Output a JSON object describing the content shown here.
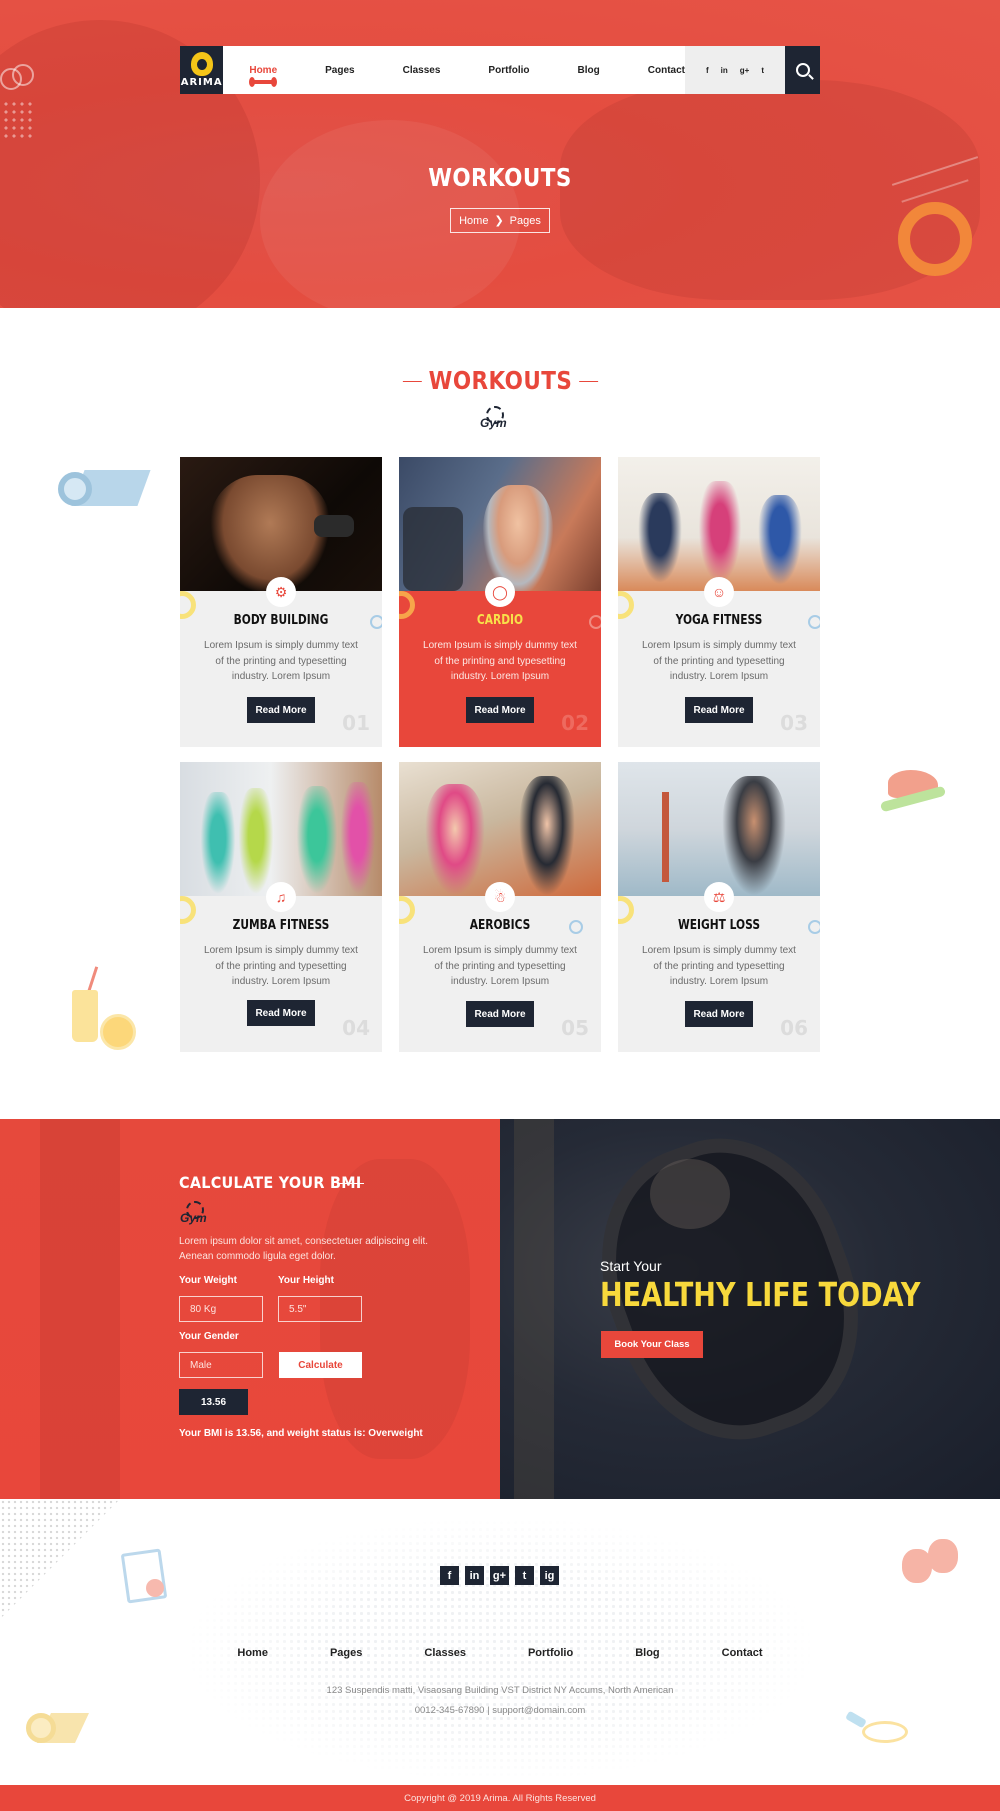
{
  "brand": {
    "name": "ARIMA",
    "accent": "#e8473b",
    "dark": "#1e2533",
    "yellow": "#f8d93c"
  },
  "nav": {
    "items": [
      {
        "label": "Home",
        "active": true
      },
      {
        "label": "Pages"
      },
      {
        "label": "Classes"
      },
      {
        "label": "Portfolio"
      },
      {
        "label": "Blog"
      },
      {
        "label": "Contact"
      }
    ],
    "social": [
      "f",
      "in",
      "g+",
      "t"
    ],
    "search_icon": "search-icon"
  },
  "hero": {
    "title": "WORKOUTS",
    "breadcrumb": {
      "home": "Home",
      "current": "Pages"
    }
  },
  "workouts": {
    "title": "WORKOUTS",
    "mark": "Gym",
    "cards": [
      {
        "title": "BODY BUILDING",
        "desc": "Lorem Ipsum is simply dummy text of the printing and typesetting industry. Lorem Ipsum",
        "button": "Read More",
        "num": "01",
        "icon": "dumbbell-icon",
        "highlight": false
      },
      {
        "title": "CARDIO",
        "desc": "Lorem Ipsum is simply dummy text of the printing and typesetting industry. Lorem Ipsum",
        "button": "Read More",
        "num": "02",
        "icon": "bike-icon",
        "highlight": true
      },
      {
        "title": "YOGA FITNESS",
        "desc": "Lorem Ipsum is simply dummy text of the printing and typesetting industry. Lorem Ipsum",
        "button": "Read More",
        "num": "03",
        "icon": "yoga-icon",
        "highlight": false
      },
      {
        "title": "ZUMBA FITNESS",
        "desc": "Lorem Ipsum is simply dummy text of the printing and typesetting industry. Lorem Ipsum",
        "button": "Read More",
        "num": "04",
        "icon": "dance-icon",
        "highlight": false
      },
      {
        "title": "AEROBICS",
        "desc": "Lorem Ipsum is simply dummy text of the printing and typesetting industry. Lorem Ipsum",
        "button": "Read More",
        "num": "05",
        "icon": "aerobics-icon",
        "highlight": false
      },
      {
        "title": "WEIGHT LOSS",
        "desc": "Lorem Ipsum is simply dummy text of the printing and typesetting industry. Lorem Ipsum",
        "button": "Read More",
        "num": "06",
        "icon": "scale-icon",
        "highlight": false
      }
    ]
  },
  "bmi": {
    "title": "CALCULATE YOUR BMI",
    "mark": "Gym",
    "desc": "Lorem ipsum dolor sit amet, consectetuer adipiscing elit. Aenean commodo ligula eget dolor.",
    "weight_label": "Your Weight",
    "weight_value": "80 Kg",
    "height_label": "Your Height",
    "height_value": "5.5\"",
    "gender_label": "Your Gender",
    "gender_value": "Male",
    "calculate": "Calculate",
    "result": "13.56",
    "status": "Your BMI is 13.56, and weight status is: Overweight"
  },
  "promo": {
    "subtitle": "Start Your",
    "title": "HEALTHY LIFE TODAY",
    "button": "Book Your Class"
  },
  "footer": {
    "social": [
      "f",
      "in",
      "g+",
      "t",
      "ig"
    ],
    "nav": [
      "Home",
      "Pages",
      "Classes",
      "Portfolio",
      "Blog",
      "Contact"
    ],
    "address": "123 Suspendis matti, Visaosang Building VST District NY Accums, North American",
    "contact": "0012-345-67890 | support@domain.com",
    "copyright": "Copyright @ 2019 Arima. All Rights Reserved"
  }
}
